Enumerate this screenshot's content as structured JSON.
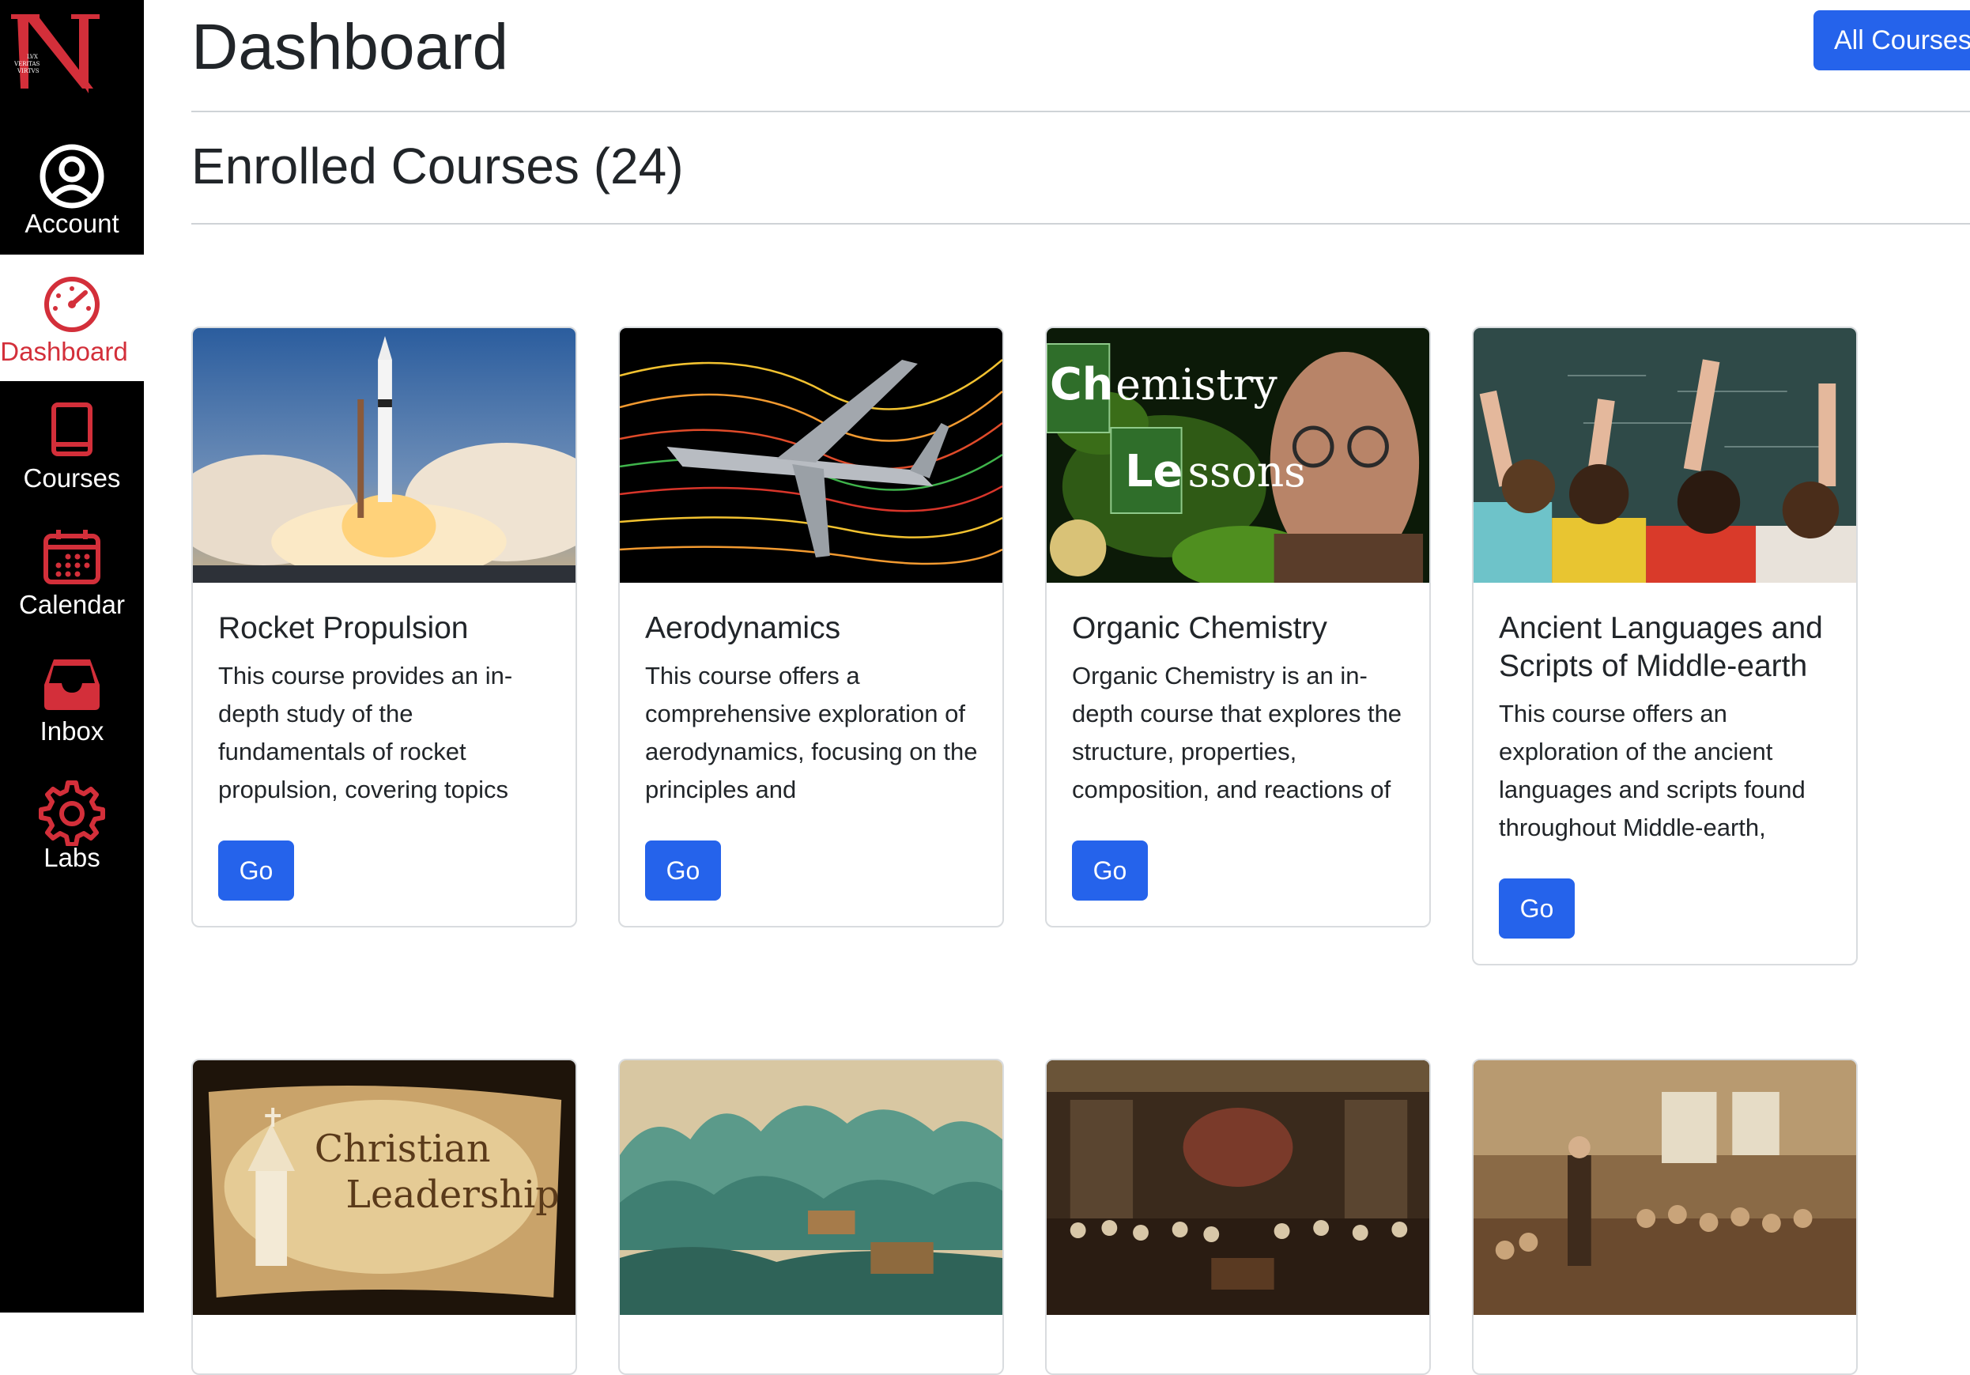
{
  "sidebar": {
    "items": [
      {
        "label": "Account",
        "icon": "user-circle-icon"
      },
      {
        "label": "Dashboard",
        "icon": "speedometer-icon",
        "active": true
      },
      {
        "label": "Courses",
        "icon": "book-icon"
      },
      {
        "label": "Calendar",
        "icon": "calendar-icon"
      },
      {
        "label": "Inbox",
        "icon": "inbox-icon"
      },
      {
        "label": "Labs",
        "icon": "gear-icon"
      }
    ]
  },
  "header": {
    "title": "Dashboard",
    "all_courses_label": "All Courses"
  },
  "enrolled": {
    "heading": "Enrolled Courses (24)"
  },
  "courses": [
    {
      "title": "Rocket Propulsion",
      "description": "This course provides an in-depth study of the fundamentals of rocket propulsion, covering topics",
      "button": "Go"
    },
    {
      "title": "Aerodynamics",
      "description": "This course offers a comprehensive exploration of aerodynamics, focusing on the principles and",
      "button": "Go"
    },
    {
      "title": "Organic Chemistry",
      "description": "Organic Chemistry is an in-depth course that explores the structure, properties, composition, and reactions of",
      "button": "Go",
      "image_text": [
        "Ch",
        "emistry",
        "Le",
        "ssons"
      ]
    },
    {
      "title": "Ancient Languages and Scripts of Middle-earth",
      "description": "This course offers an exploration of the ancient languages and scripts found throughout Middle-earth,",
      "button": "Go"
    }
  ],
  "second_row": {
    "first_image_text": [
      "Christian",
      "Leadership"
    ]
  },
  "colors": {
    "sidebar_bg": "#000000",
    "accent_red": "#d32f3a",
    "button_blue": "#2563eb"
  }
}
